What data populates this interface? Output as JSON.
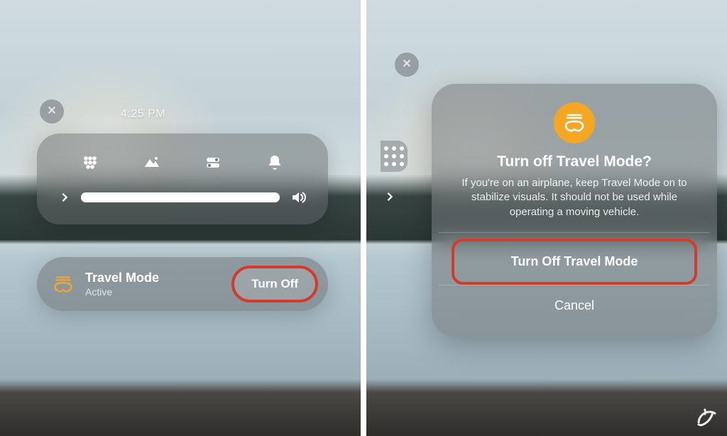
{
  "left": {
    "time": "4:25 PM",
    "icons": {
      "apps": "apps-icon",
      "environment": "environment-icon",
      "controls": "controls-icon",
      "notifications": "notifications-icon",
      "expand": "chevron-right-icon",
      "volume": "volume-icon"
    },
    "volume_percent": 100,
    "travel_mode": {
      "title": "Travel Mode",
      "status": "Active",
      "button_label": "Turn Off"
    }
  },
  "right": {
    "dialog": {
      "title": "Turn off Travel Mode?",
      "body": "If you're on an airplane, keep Travel Mode on to stabilize visuals. It should not be used while operating a moving vehicle.",
      "primary": "Turn Off Travel Mode",
      "cancel": "Cancel"
    }
  },
  "colors": {
    "accent": "#f5a623",
    "highlight": "#d63a2b"
  }
}
